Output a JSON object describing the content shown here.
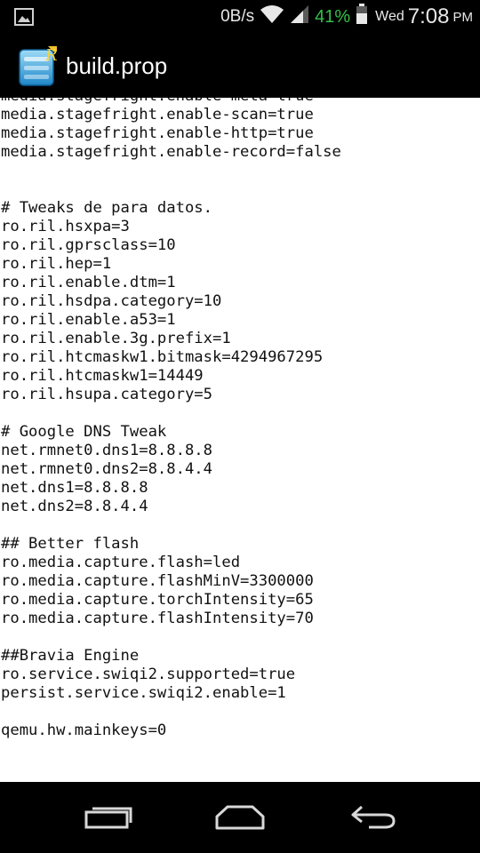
{
  "status_bar": {
    "network_speed": "0B/s",
    "battery_percent": "41%",
    "day": "Wed",
    "time": "7:08",
    "ampm": "PM",
    "icons": [
      "image-notification-icon",
      "wifi-icon",
      "signal-icon",
      "battery-icon"
    ],
    "battery_color": "#33c04a"
  },
  "app_bar": {
    "title": "build.prop",
    "icon": "build-prop-editor-app-icon"
  },
  "file": {
    "lines": [
      "media.stagefright.enable-meta=true",
      "media.stagefright.enable-scan=true",
      "media.stagefright.enable-http=true",
      "media.stagefright.enable-record=false",
      "",
      "",
      "# Tweaks de para datos.",
      "ro.ril.hsxpa=3",
      "ro.ril.gprsclass=10",
      "ro.ril.hep=1",
      "ro.ril.enable.dtm=1",
      "ro.ril.hsdpa.category=10",
      "ro.ril.enable.a53=1",
      "ro.ril.enable.3g.prefix=1",
      "ro.ril.htcmaskw1.bitmask=4294967295",
      "ro.ril.htcmaskw1=14449",
      "ro.ril.hsupa.category=5",
      "",
      "# Google DNS Tweak",
      "net.rmnet0.dns1=8.8.8.8",
      "net.rmnet0.dns2=8.8.4.4",
      "net.dns1=8.8.8.8",
      "net.dns2=8.8.4.4",
      "",
      "## Better flash",
      "ro.media.capture.flash=led",
      "ro.media.capture.flashMinV=3300000",
      "ro.media.capture.torchIntensity=65",
      "ro.media.capture.flashIntensity=70",
      "",
      "##Bravia Engine",
      "ro.service.swiqi2.supported=true",
      "persist.service.swiqi2.enable=1",
      "",
      "qemu.hw.mainkeys=0"
    ]
  },
  "nav_bar": {
    "buttons": [
      "recent-apps-icon",
      "home-icon",
      "back-icon"
    ]
  }
}
